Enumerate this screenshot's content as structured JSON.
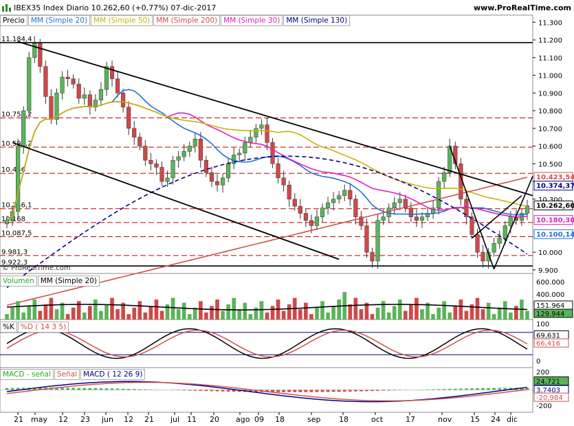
{
  "header": {
    "title": "IBEX35 Index   Diario   10.262,60 (+0,77%)   07-dic-2017",
    "site": "www.ProRealTime.com",
    "watermark": "© ProRealTime.com"
  },
  "legend_main": [
    {
      "label": "Precio",
      "color": "#000000"
    },
    {
      "label": "MM (Simple 20)",
      "color": "#1f6fd8"
    },
    {
      "label": "MM (Simple 50)",
      "color": "#c8b400"
    },
    {
      "label": "MM (Simple 200)",
      "color": "#d0504a"
    },
    {
      "label": "MM (Simple 30)",
      "color": "#e020c0"
    },
    {
      "label": "MM (Simple 130)",
      "color": "#00008b"
    }
  ],
  "legend_volume": [
    {
      "label": "Volumen",
      "color": "#22aa22"
    },
    {
      "label": "MM (Simple 20)",
      "color": "#000000"
    }
  ],
  "legend_stoch": [
    {
      "label": "%K",
      "color": "#000000"
    },
    {
      "label": "%D ( 14 3 5)",
      "color": "#d0504a"
    }
  ],
  "legend_macd": [
    {
      "label": "MACD - señal",
      "color": "#22aa22"
    },
    {
      "label": "Señal",
      "color": "#d0504a"
    },
    {
      "label": "MACD ( 12 26 9)",
      "color": "#00008b"
    }
  ],
  "left_levels": [
    "11.184,4",
    "10.759,2",
    "10.594,2",
    "10.446",
    "10.246,1",
    "10.168",
    "10.087,5",
    "9.981,3",
    "9.922,3"
  ],
  "x_labels": [
    "21",
    "may",
    "12",
    "23",
    "jun",
    "12",
    "21",
    "jul",
    "11",
    "20",
    "ago",
    "09",
    "18",
    "sep",
    "18",
    "oct",
    "17",
    "nov",
    "15",
    "24",
    "dic"
  ],
  "price_axis": [
    "11.300",
    "11.200",
    "11.100",
    "11.000",
    "10.900",
    "10.800",
    "10.700",
    "10.600",
    "10.500",
    "10.400",
    "10.300",
    "10.000",
    "9.900"
  ],
  "price_tags": [
    {
      "label": "10.423,54",
      "color": "#d0504a"
    },
    {
      "label": "10.374,37",
      "color": "#00008b"
    },
    {
      "label": "10.262,60",
      "color": "#000000"
    },
    {
      "label": "10.180,30",
      "color": "#e020c0"
    },
    {
      "label": "10.100,14",
      "color": "#1f6fd8"
    }
  ],
  "volume_axis": [
    "600.000",
    "400.000",
    "151.964",
    "129.944"
  ],
  "stoch_axis": [
    "100",
    "69,631",
    "66,416",
    "0"
  ],
  "macd_axis": [
    "200",
    "24,721",
    "3,7403",
    "-20,984",
    "-200"
  ],
  "chart_data": {
    "type": "candlestick",
    "title": "IBEX35 Index Diario",
    "ylim": [
      9880,
      11340
    ],
    "horizontal_levels": [
      11184.4,
      10759.2,
      10594.2,
      10446,
      10246.1,
      10168,
      10087.5,
      9981.3,
      9922.3
    ],
    "closes": [
      10180,
      10230,
      10600,
      10800,
      11100,
      11180,
      11050,
      10880,
      10750,
      10900,
      10990,
      10980,
      10950,
      10870,
      10890,
      10820,
      10860,
      10920,
      11050,
      10980,
      10900,
      10820,
      10700,
      10650,
      10600,
      10520,
      10500,
      10480,
      10400,
      10420,
      10520,
      10540,
      10570,
      10600,
      10640,
      10520,
      10450,
      10400,
      10380,
      10420,
      10500,
      10550,
      10560,
      10620,
      10650,
      10700,
      10720,
      10620,
      10500,
      10420,
      10380,
      10300,
      10260,
      10220,
      10180,
      10150,
      10200,
      10250,
      10280,
      10300,
      10320,
      10350,
      10300,
      10200,
      10150,
      10000,
      9950,
      10180,
      10200,
      10250,
      10280,
      10300,
      10250,
      10200,
      10180,
      10200,
      10220,
      10250,
      10400,
      10450,
      10600,
      10500,
      10300,
      10200,
      10100,
      10000,
      9950,
      10000,
      10050,
      10080,
      10150,
      10200,
      10180,
      10220,
      10262.6
    ],
    "series": [
      {
        "name": "MM (Simple 20)",
        "last": 10100.14
      },
      {
        "name": "MM (Simple 50)",
        "last": 10185.0
      },
      {
        "name": "MM (Simple 200)",
        "last": 10423.54
      },
      {
        "name": "MM (Simple 30)",
        "last": 10180.3
      },
      {
        "name": "MM (Simple 130)",
        "last": 10374.37
      }
    ],
    "last_price": 10262.6,
    "change_pct": 0.77,
    "date": "07-dic-2017",
    "volume": {
      "mm20": 151964,
      "last": 129944
    },
    "stochastic": {
      "k": 69.631,
      "d": 66.416
    },
    "macd": {
      "macd_minus_signal": 24.721,
      "signal": -20.984,
      "macd": 3.7403
    }
  }
}
